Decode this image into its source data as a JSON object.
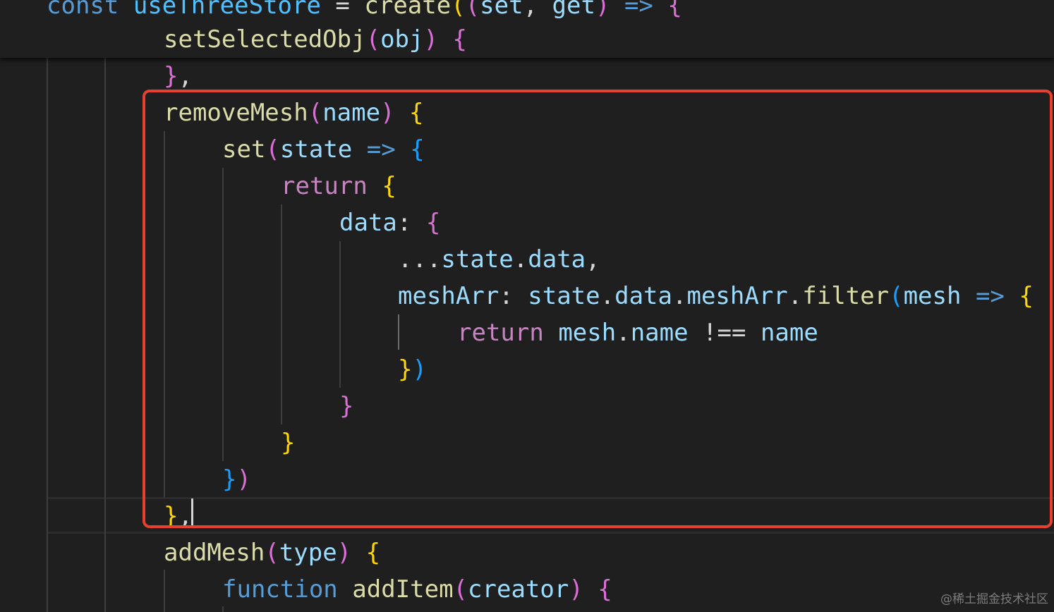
{
  "header_lines": [
    "const useThreeStore = create((set, get) => {",
    "    setSelectedObj(obj) {"
  ],
  "code_lines": [
    "    },",
    "    removeMesh(name) {",
    "        set(state => {",
    "            return {",
    "                data: {",
    "                    ...state.data,",
    "                    meshArr: state.data.meshArr.filter(mesh => {",
    "                        return mesh.name !== name",
    "                    })",
    "                }",
    "            }",
    "        })",
    "    },",
    "    addMesh(type) {",
    "        function addItem(creator) {"
  ],
  "watermark": "@稀土掘金技术社区",
  "colors": {
    "background": "#1f1f1f",
    "keyword": "#569cd6",
    "function": "#dcdcaa",
    "variable": "#9cdcfe",
    "control": "#c586c0",
    "bracket_gold": "#ffd700",
    "bracket_orchid": "#da70d6",
    "bracket_blue": "#179fff",
    "highlight_box": "#e8402f"
  }
}
